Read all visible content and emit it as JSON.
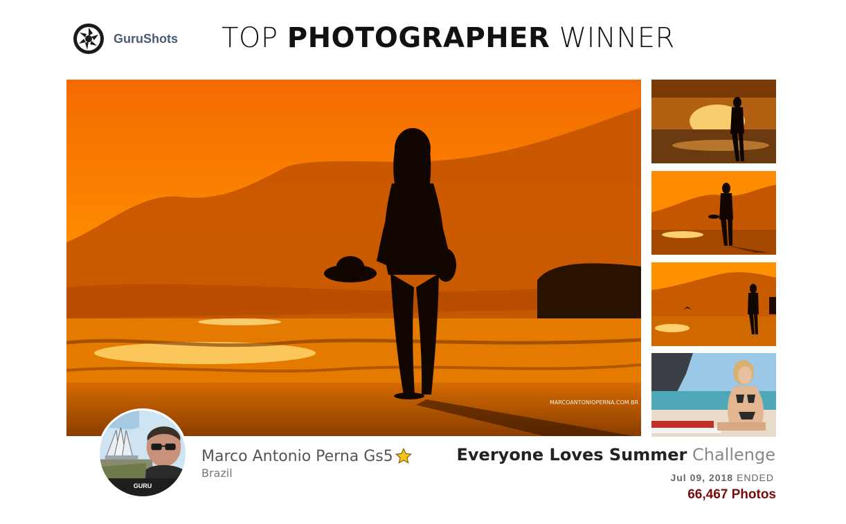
{
  "brand": {
    "name": "GuruShots",
    "logo_icon": "aperture-icon"
  },
  "header": {
    "title_part1": "TOP ",
    "title_bold": "PHOTOGRAPHER",
    "title_part2": " WINNER"
  },
  "main_photo": {
    "watermark": "MARCOANTONIOPERNA.COM.BR"
  },
  "winner": {
    "name": "Marco Antonio Perna Gs5",
    "country": "Brazil",
    "badge": "GURU",
    "rank_icon": "star-icon"
  },
  "challenge": {
    "name": "Everyone Loves Summer",
    "suffix": " Challenge",
    "date": "Jul 09, 2018",
    "status": " ENDED",
    "photo_count": "66,467 Photos"
  },
  "colors": {
    "accent_count": "#7a0a0a",
    "sunset_orange": "#ff8a00",
    "brand_text": "#4a5a78"
  }
}
